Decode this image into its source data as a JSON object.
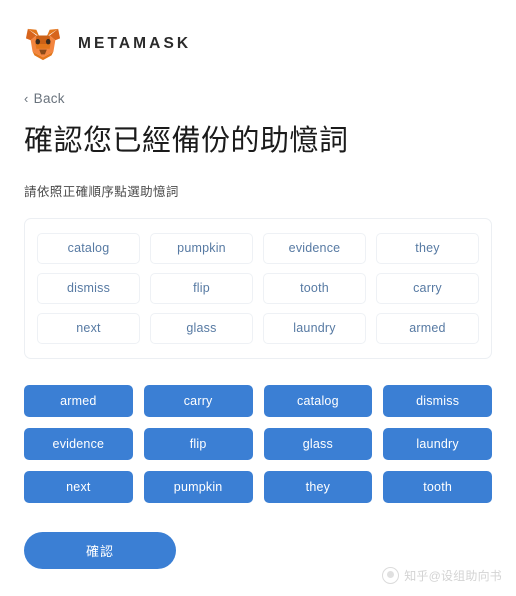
{
  "header": {
    "brand_name": "METAMASK",
    "logo_icon": "metamask-fox-icon"
  },
  "navigation": {
    "back_label": "Back",
    "back_chevron": "‹"
  },
  "main": {
    "title": "確認您已經備份的助憶詞",
    "subtitle": "請依照正確順序點選助憶詞"
  },
  "selected_words": [
    "catalog",
    "pumpkin",
    "evidence",
    "they",
    "dismiss",
    "flip",
    "tooth",
    "carry",
    "next",
    "glass",
    "laundry",
    "armed"
  ],
  "word_pool": [
    "armed",
    "carry",
    "catalog",
    "dismiss",
    "evidence",
    "flip",
    "glass",
    "laundry",
    "next",
    "pumpkin",
    "they",
    "tooth"
  ],
  "actions": {
    "confirm_label": "確認"
  },
  "watermark": {
    "text": "知乎@设组助向书",
    "avatar_icon": "user-avatar-icon"
  },
  "colors": {
    "accent_blue": "#3b7fd4",
    "chip_text": "#577aa3",
    "chip_border": "#eef1f5",
    "panel_border": "#eceff3",
    "title_text": "#1b1b1b",
    "muted_text": "#6a737d"
  }
}
